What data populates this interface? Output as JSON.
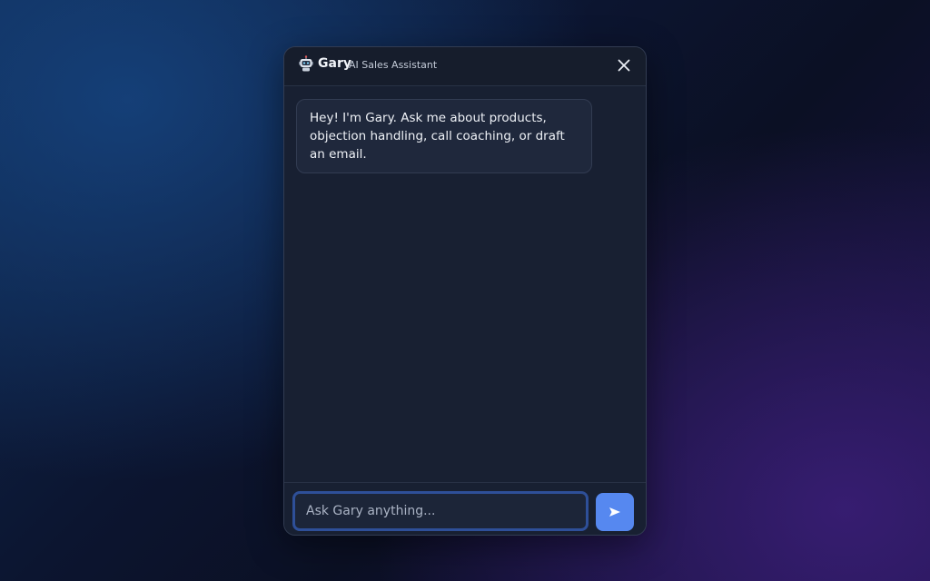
{
  "chat": {
    "title": "Gary",
    "subtitle": "AI Sales Assistant",
    "header_icon": "robot-icon",
    "close_icon": "close-icon",
    "messages": [
      {
        "from": "assistant",
        "text": "Hey! I'm Gary. Ask me about products, objection handling, call coaching, or draft an email."
      }
    ],
    "input": {
      "value": "",
      "placeholder": "Ask Gary anything..."
    },
    "send_icon": "send-icon",
    "colors": {
      "panel": "#182032",
      "accent": "#5688f0",
      "input_border": "#2e4f98"
    }
  }
}
